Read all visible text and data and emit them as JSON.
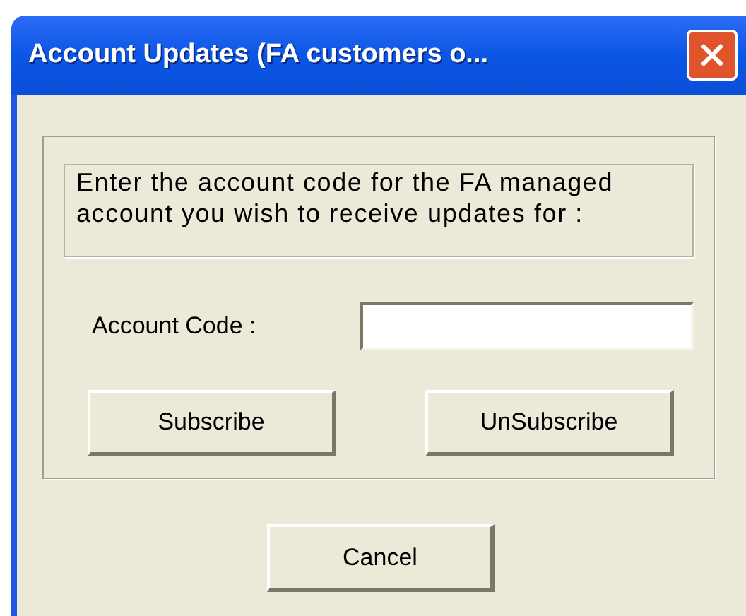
{
  "window": {
    "title": "Account Updates (FA customers o..."
  },
  "instructions": "Enter the account code for the FA managed account you wish to receive updates for :",
  "account_code": {
    "label": "Account Code :"
  },
  "buttons": [
    {
      "label": "Subscribe"
    },
    {
      "label": "UnSubscribe"
    }
  ],
  "cancel": {
    "label": "Cancel"
  }
}
